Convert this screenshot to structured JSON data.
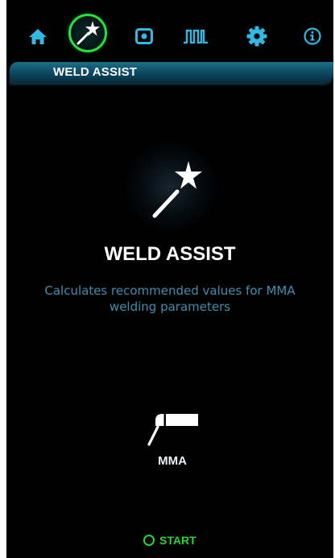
{
  "nav": {
    "items": [
      {
        "icon": "home-icon",
        "active": false
      },
      {
        "icon": "magic-wand-icon",
        "active": true
      },
      {
        "icon": "memory-card-icon",
        "active": false
      },
      {
        "icon": "pulse-wave-icon",
        "active": false
      },
      {
        "icon": "gear-icon",
        "active": false
      },
      {
        "icon": "info-icon",
        "active": false
      }
    ],
    "active_color": "#23e23b",
    "icon_color": "#2fb9e3"
  },
  "header": {
    "title": "WELD ASSIST"
  },
  "hero": {
    "icon": "magic-wand-icon",
    "title": "WELD ASSIST",
    "description": "Calculates recommended values for MMA welding parameters",
    "description_color": "#3d8fb1"
  },
  "process": {
    "icon": "mma-electrode-holder-icon",
    "label": "MMA"
  },
  "start": {
    "label": "START",
    "color": "#27d62d"
  }
}
